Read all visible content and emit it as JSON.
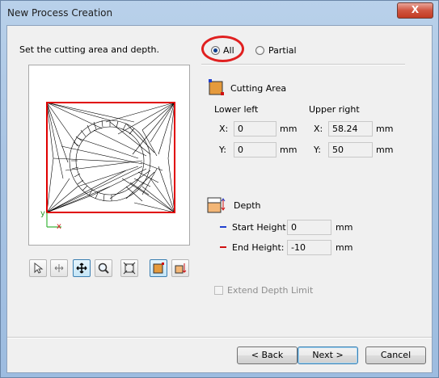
{
  "window": {
    "title": "New Process Creation",
    "close_glyph": "X"
  },
  "instructions": "Set the cutting area and depth.",
  "mode": {
    "all_label": "All",
    "partial_label": "Partial",
    "selected": "All"
  },
  "cutting_area": {
    "title": "Cutting Area",
    "lower_left": {
      "heading": "Lower left",
      "x_label": "X:",
      "x_value": "0",
      "y_label": "Y:",
      "y_value": "0",
      "unit": "mm"
    },
    "upper_right": {
      "heading": "Upper right",
      "x_label": "X:",
      "x_value": "58.24",
      "y_label": "Y:",
      "y_value": "50",
      "unit": "mm"
    }
  },
  "depth": {
    "title": "Depth",
    "start_label": "Start Height:",
    "start_value": "0",
    "end_label": "End Height:",
    "end_value": "-10",
    "unit": "mm",
    "start_color": "#1f3fcf",
    "end_color": "#d01010"
  },
  "extend_depth_limit": {
    "label": "Extend Depth Limit",
    "checked": false,
    "enabled": false
  },
  "preview": {
    "axis_y": "y",
    "axis_x": "x",
    "boundary_color": "#e00000"
  },
  "toolbar": {
    "tools": [
      "select-icon",
      "rotate-icon",
      "pan-icon",
      "zoom-icon",
      "fit-icon",
      "cutting-area-icon",
      "depth-icon"
    ]
  },
  "buttons": {
    "back": "< Back",
    "next": "Next >",
    "cancel": "Cancel"
  },
  "annotation_color": "#e02020"
}
